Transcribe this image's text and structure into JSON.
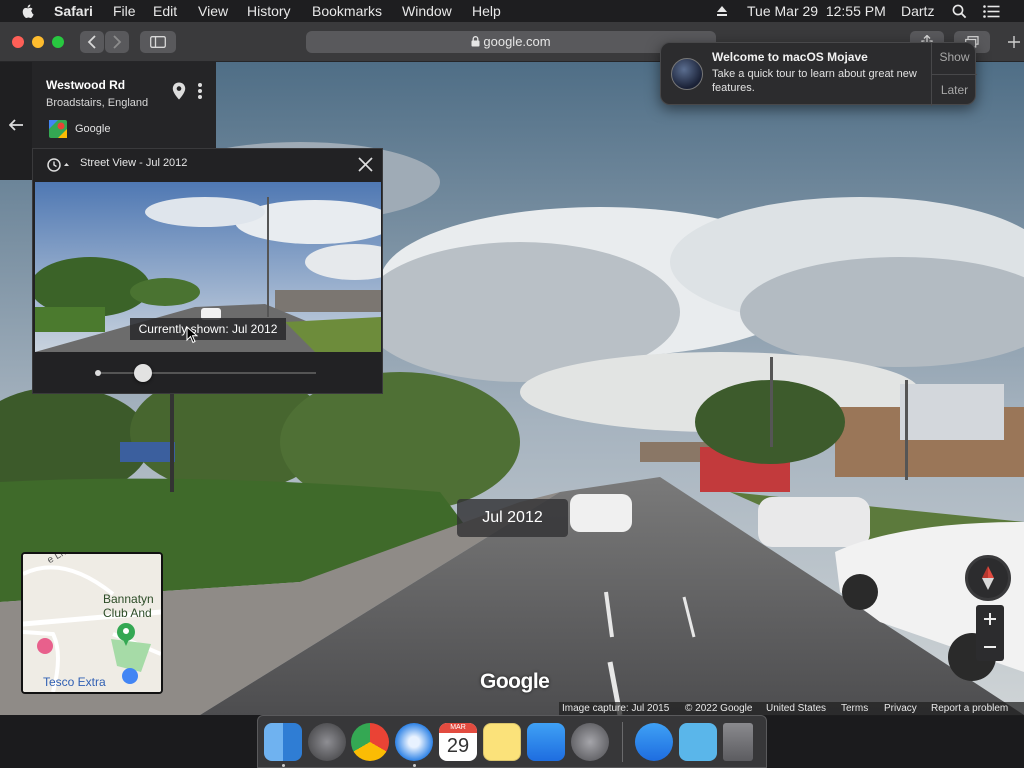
{
  "menubar": {
    "app_name": "Safari",
    "menus": [
      "File",
      "Edit",
      "View",
      "History",
      "Bookmarks",
      "Window",
      "Help"
    ],
    "datetime": "Tue Mar 29  12:55 PM",
    "user": "Dartz"
  },
  "browser": {
    "url": "google.com"
  },
  "address_card": {
    "title": "Westwood Rd",
    "subtitle": "Broadstairs, England",
    "source": "Google"
  },
  "street_view_panel": {
    "title": "Street View - Jul 2012",
    "tooltip": "Currently shown: Jul 2012",
    "slider_position": 0.21
  },
  "notification": {
    "title": "Welcome to macOS Mojave",
    "body": "Take a quick tour to learn about great new features.",
    "show_label": "Show",
    "later_label": "Later"
  },
  "date_label": "Jul 2012",
  "minimap": {
    "labels": [
      "Bannatyn",
      "Club And",
      "Tesco Extra",
      "e Ln"
    ]
  },
  "watermark": "Google",
  "footer": {
    "capture": "Image capture: Jul 2015",
    "copyright": "© 2022 Google",
    "region": "United States",
    "terms": "Terms",
    "privacy": "Privacy",
    "report": "Report a problem"
  },
  "dock": {
    "calendar_month": "MAR",
    "calendar_day": "29"
  },
  "colors": {
    "menubar": "#1e1e20",
    "toolbar": "#3a3a3c",
    "panel": "#222224",
    "notification": "#2c2c2e"
  }
}
